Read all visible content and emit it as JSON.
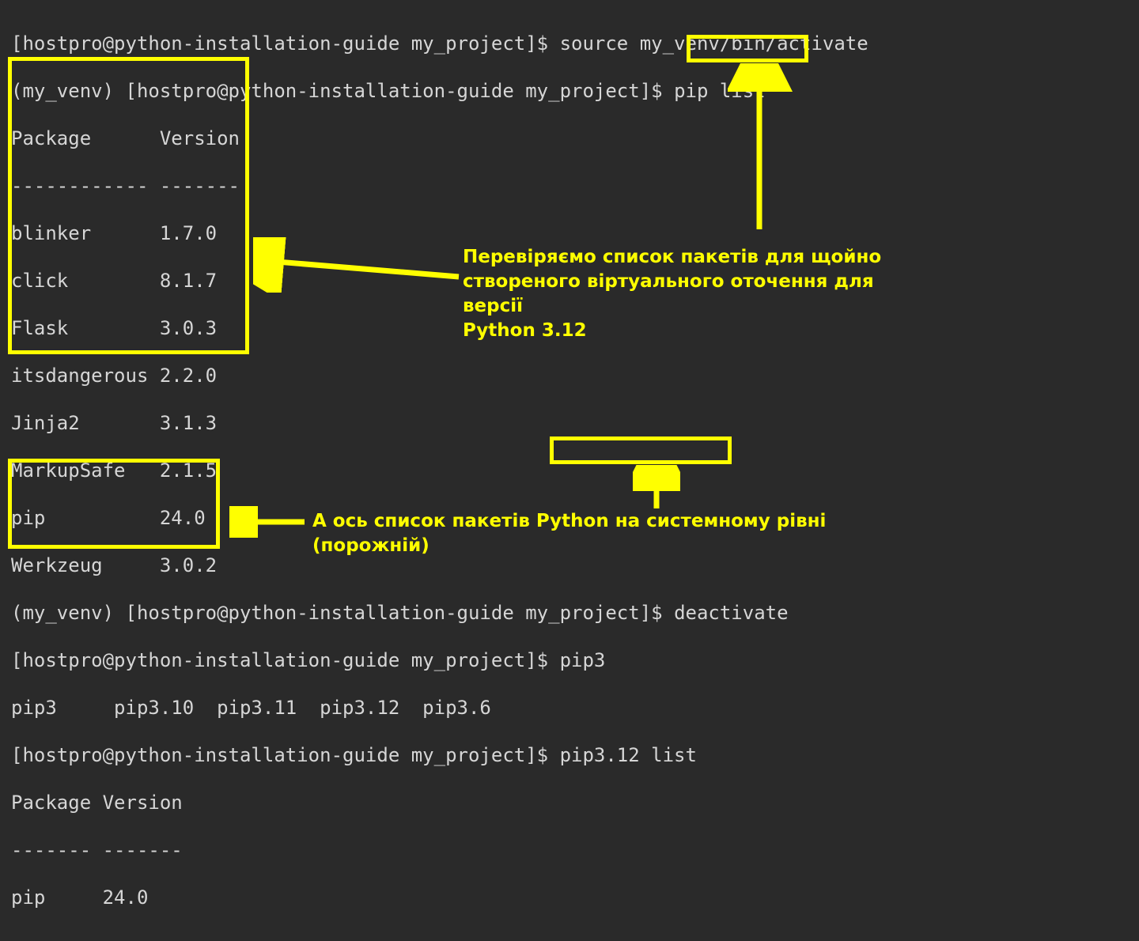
{
  "lines": {
    "l1_prompt": "[hostpro@python-installation-guide my_project]$ ",
    "l1_cmd": "source my_venv/bin/activate",
    "l2_prompt": "(my_venv) [hostpro@python-installation-guide my_project]$ ",
    "l2_cmd": "pip list",
    "l3": "Package      Version",
    "l4": "------------ -------",
    "l5": "blinker      1.7.0",
    "l6": "click        8.1.7",
    "l7": "Flask        3.0.3",
    "l8": "itsdangerous 2.2.0",
    "l9": "Jinja2       3.1.3",
    "l10": "MarkupSafe   2.1.5",
    "l11": "pip          24.0",
    "l12": "Werkzeug     3.0.2",
    "l13_prompt": "(my_venv) [hostpro@python-installation-guide my_project]$ ",
    "l13_cmd": "deactivate",
    "l14_prompt": "[hostpro@python-installation-guide my_project]$ ",
    "l14_cmd": "pip3",
    "l15": "pip3     pip3.10  pip3.11  pip3.12  pip3.6   ",
    "l16_prompt": "[hostpro@python-installation-guide my_project]$ ",
    "l16_cmd": "pip3.12 list",
    "l17": "Package Version",
    "l18": "------- -------",
    "l19": "pip     24.0"
  },
  "annotations": {
    "ann1": "Перевіряємо список пакетів для щойно\nствореного віртуального оточення для версії\nPython 3.12",
    "ann2": "А ось список пакетів Python на системному рівні (порожній)"
  },
  "table_venv": {
    "header": [
      "Package",
      "Version"
    ],
    "rows": [
      [
        "blinker",
        "1.7.0"
      ],
      [
        "click",
        "8.1.7"
      ],
      [
        "Flask",
        "3.0.3"
      ],
      [
        "itsdangerous",
        "2.2.0"
      ],
      [
        "Jinja2",
        "3.1.3"
      ],
      [
        "MarkupSafe",
        "2.1.5"
      ],
      [
        "pip",
        "24.0"
      ],
      [
        "Werkzeug",
        "3.0.2"
      ]
    ]
  },
  "table_system": {
    "header": [
      "Package",
      "Version"
    ],
    "rows": [
      [
        "pip",
        "24.0"
      ]
    ]
  }
}
